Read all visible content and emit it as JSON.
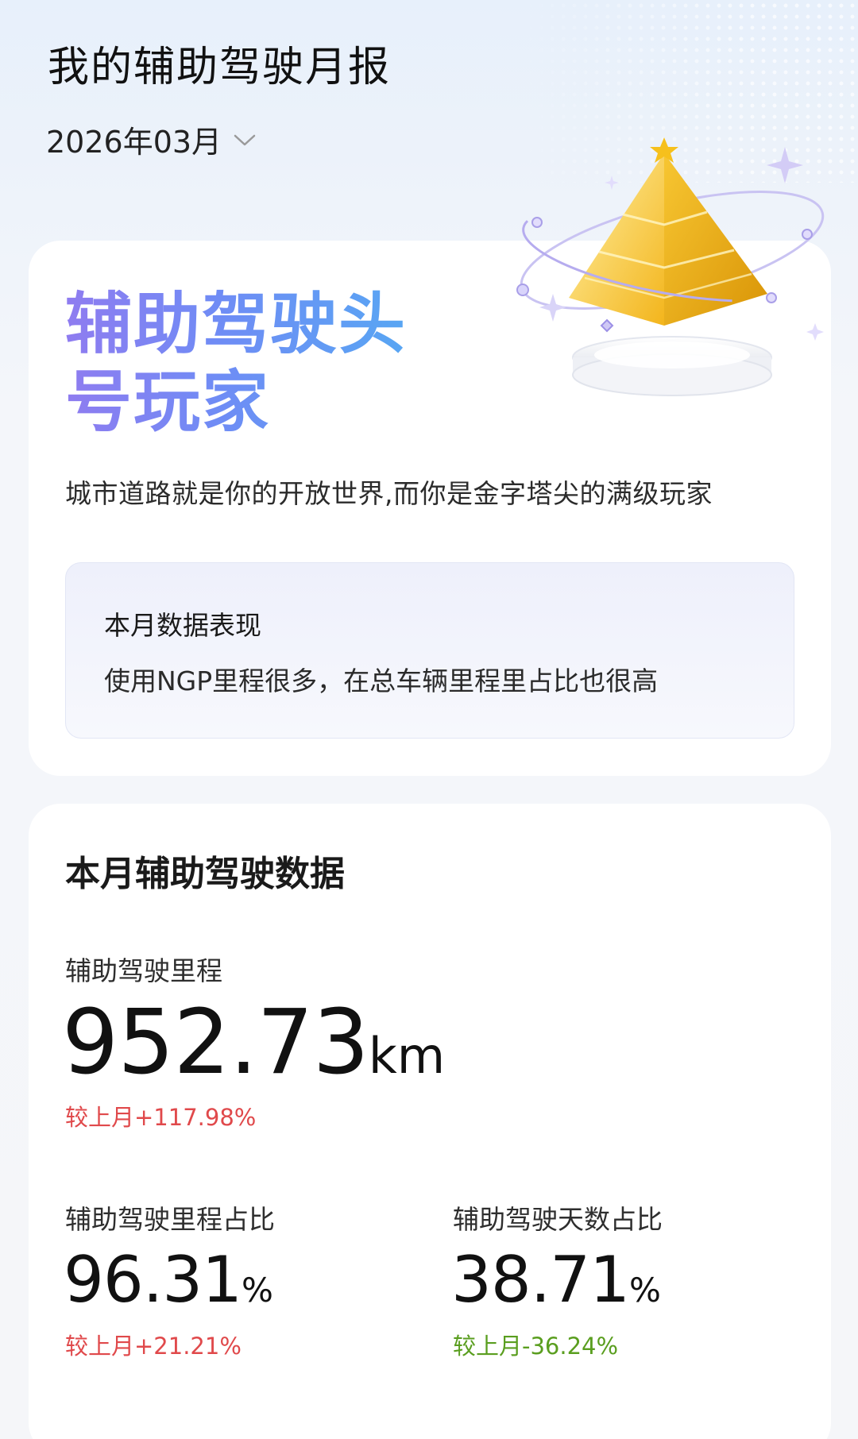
{
  "header": {
    "title": "我的辅助驾驶月报",
    "month": "2026年03月"
  },
  "badge_card": {
    "title_line1": "辅助驾驶头",
    "title_line2": "号玩家",
    "subtitle": "城市道路就是你的开放世界,而你是金字塔尖的满级玩家",
    "performance": {
      "heading": "本月数据表现",
      "text": "使用NGP里程很多，在总车辆里程里占比也很高"
    }
  },
  "stats_card": {
    "heading": "本月辅助驾驶数据",
    "mileage": {
      "label": "辅助驾驶里程",
      "value": "952.73",
      "unit": "km",
      "delta": "较上月+117.98%"
    },
    "mileage_ratio": {
      "label": "辅助驾驶里程占比",
      "value": "96.31",
      "unit": "%",
      "delta": "较上月+21.21%"
    },
    "days_ratio": {
      "label": "辅助驾驶天数占比",
      "value": "38.71",
      "unit": "%",
      "delta": "较上月-36.24%"
    }
  },
  "colors": {
    "positive_delta": "#e0494b",
    "negative_delta": "#5a9e1f",
    "hero_gradient_start": "#8f7cf0",
    "hero_gradient_end": "#58a6f3"
  },
  "icons": {
    "month_dropdown": "chevron-down-icon",
    "badge_illustration": "gold-pyramid-trophy-icon"
  }
}
